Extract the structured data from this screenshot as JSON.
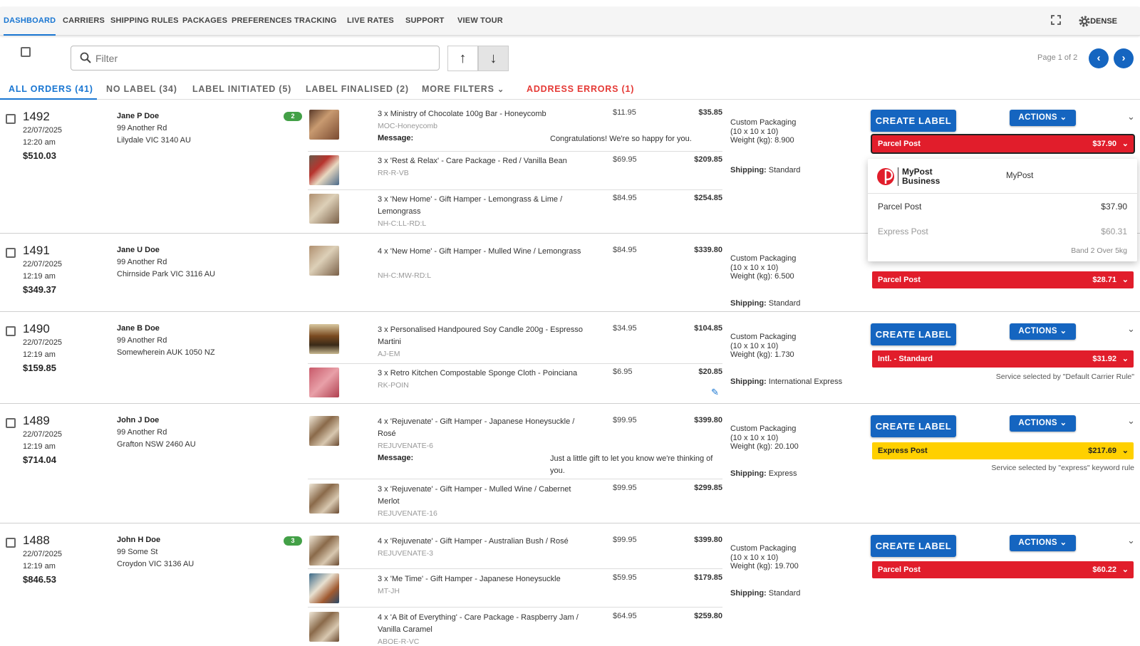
{
  "nav": {
    "items": [
      "DASHBOARD",
      "CARRIERS",
      "SHIPPING RULES",
      "PACKAGES",
      "PREFERENCES",
      "TRACKING",
      "LIVE RATES",
      "SUPPORT",
      "VIEW TOUR"
    ],
    "dense_label": "DENSE",
    "active_index": 0
  },
  "toolbar": {
    "filter_placeholder": "Filter",
    "page_info": "Page 1 of 2"
  },
  "tabs": [
    "ALL ORDERS (41)",
    "NO LABEL (34)",
    "LABEL INITIATED (5)",
    "LABEL FINALISED (2)",
    "MORE FILTERS",
    "ADDRESS ERRORS (1)"
  ],
  "labels": {
    "create_label": "CREATE LABEL",
    "actions": "ACTIONS",
    "message": "Message:",
    "shipping": "Shipping:"
  },
  "dropdown": {
    "logo_line1": "MyPost",
    "logo_line2": "Business",
    "carrier": "MyPost",
    "options": [
      {
        "name": "Parcel Post",
        "price": "$37.90"
      },
      {
        "name": "Express Post",
        "price": "$60.31"
      }
    ],
    "band": "Band 2 Over 5kg"
  },
  "orders": [
    {
      "number": "1492",
      "date": "22/07/2025",
      "time": "12:20 am",
      "total": "$510.03",
      "name": "Jane P Doe",
      "addr1": "99 Another Rd",
      "addr2": "Lilydale VIC 3140 AU",
      "badge": "2",
      "items": [
        {
          "qty": "3 x",
          "name": "Ministry of Chocolate 100g Bar - Honeycomb",
          "sku": "MOC-Honeycomb",
          "price": "$11.95",
          "total": "$35.85",
          "message": "Congratulations! We're so happy for you."
        },
        {
          "qty": "3 x",
          "name": "'Rest & Relax' - Care Package - Red / Vanilla Bean",
          "sku": "RR-R-VB",
          "price": "$69.95",
          "total": "$209.85"
        },
        {
          "qty": "3 x",
          "name": "'New Home' - Gift Hamper - Lemongrass & Lime / Lemongrass",
          "sku": "NH-C:LL-RD:L",
          "price": "$84.95",
          "total": "$254.85"
        }
      ],
      "package": [
        "Custom Packaging",
        "(10 x 10 x 10)",
        "Weight (kg): 8.900"
      ],
      "shipping": "Standard",
      "service": {
        "name": "Parcel Post",
        "price": "$37.90",
        "color": "#e11d2b"
      }
    },
    {
      "number": "1491",
      "date": "22/07/2025",
      "time": "12:19 am",
      "total": "$349.37",
      "name": "Jane U Doe",
      "addr1": "99 Another Rd",
      "addr2": "Chirnside Park VIC 3116 AU",
      "items": [
        {
          "qty": "4 x",
          "name": "'New Home' - Gift Hamper - Mulled Wine / Lemongrass",
          "sku": "NH-C:MW-RD:L",
          "price": "$84.95",
          "total": "$339.80"
        }
      ],
      "package": [
        "Custom Packaging",
        "(10 x 10 x 10)",
        "Weight (kg): 6.500"
      ],
      "shipping": "Standard",
      "service": {
        "name": "Parcel Post",
        "price": "$28.71",
        "color": "#e11d2b"
      }
    },
    {
      "number": "1490",
      "date": "22/07/2025",
      "time": "12:19 am",
      "total": "$159.85",
      "name": "Jane B Doe",
      "addr1": "99 Another Rd",
      "addr2": "Somewherein AUK 1050 NZ",
      "items": [
        {
          "qty": "3 x",
          "name": "Personalised Handpoured Soy Candle 200g - Espresso Martini",
          "sku": "AJ-EM",
          "price": "$34.95",
          "total": "$104.85"
        },
        {
          "qty": "3 x",
          "name": "Retro Kitchen Compostable Sponge Cloth - Poinciana",
          "sku": "RK-POIN",
          "price": "$6.95",
          "total": "$20.85"
        }
      ],
      "package": [
        "Custom Packaging",
        "(10 x 10 x 10)",
        "Weight (kg): 1.730"
      ],
      "shipping": "International Express",
      "service": {
        "name": "Intl. - Standard",
        "price": "$31.92",
        "color": "#e11d2b"
      },
      "note": "Service selected by \"Default Carrier Rule\""
    },
    {
      "number": "1489",
      "date": "22/07/2025",
      "time": "12:19 am",
      "total": "$714.04",
      "name": "John J Doe",
      "addr1": "99 Another Rd",
      "addr2": "Grafton NSW 2460 AU",
      "items": [
        {
          "qty": "4 x",
          "name": "'Rejuvenate' - Gift Hamper - Japanese Honeysuckle / Rosé",
          "sku": "REJUVENATE-6",
          "price": "$99.95",
          "total": "$399.80",
          "message": "Just a little gift to let you know we're thinking of you."
        },
        {
          "qty": "3 x",
          "name": "'Rejuvenate' - Gift Hamper - Mulled Wine / Cabernet Merlot",
          "sku": "REJUVENATE-16",
          "price": "$99.95",
          "total": "$299.85"
        }
      ],
      "package": [
        "Custom Packaging",
        "(10 x 10 x 10)",
        "Weight (kg): 20.100"
      ],
      "shipping": "Express",
      "service": {
        "name": "Express Post",
        "price": "$217.69",
        "color": "#ffd000"
      },
      "note": "Service selected by \"express\" keyword rule"
    },
    {
      "number": "1488",
      "date": "22/07/2025",
      "time": "12:19 am",
      "total": "$846.53",
      "name": "John H Doe",
      "addr1": "99 Some St",
      "addr2": "Croydon VIC 3136 AU",
      "badge": "3",
      "items": [
        {
          "qty": "4 x",
          "name": "'Rejuvenate' - Gift Hamper - Australian Bush / Rosé",
          "sku": "REJUVENATE-3",
          "price": "$99.95",
          "total": "$399.80"
        },
        {
          "qty": "3 x",
          "name": "'Me Time' - Gift Hamper - Japanese Honeysuckle",
          "sku": "MT-JH",
          "price": "$59.95",
          "total": "$179.85"
        },
        {
          "qty": "4 x",
          "name": "'A Bit of Everything' - Care Package - Raspberry Jam / Vanilla Caramel",
          "sku": "ABOE-R-VC",
          "price": "$64.95",
          "total": "$259.80"
        }
      ],
      "package": [
        "Custom Packaging",
        "(10 x 10 x 10)",
        "Weight (kg): 19.700"
      ],
      "shipping": "Standard",
      "service": {
        "name": "Parcel Post",
        "price": "$60.22",
        "color": "#e11d2b"
      }
    }
  ]
}
